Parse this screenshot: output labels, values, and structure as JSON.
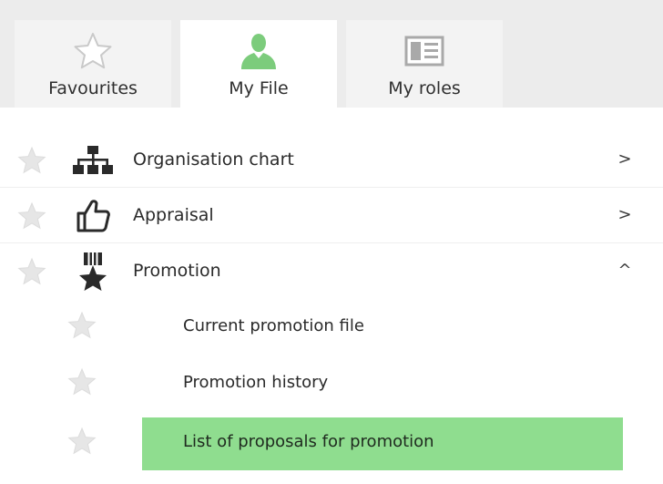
{
  "tabs": [
    {
      "label": "Favourites",
      "icon": "star-icon",
      "active": false
    },
    {
      "label": "My File",
      "icon": "person-icon",
      "active": true
    },
    {
      "label": "My roles",
      "icon": "id-card-icon",
      "active": false
    }
  ],
  "menu": {
    "items": [
      {
        "label": "Organisation chart",
        "icon": "org-chart-icon",
        "chevron": ">"
      },
      {
        "label": "Appraisal",
        "icon": "thumbs-up-icon",
        "chevron": ">"
      },
      {
        "label": "Promotion",
        "icon": "medal-icon",
        "chevron": "^"
      }
    ],
    "promotion_sub": [
      {
        "label": "Current promotion file"
      },
      {
        "label": "Promotion history"
      },
      {
        "label": "List of proposals for promotion",
        "selected": true
      }
    ]
  },
  "colors": {
    "accent_green": "#8fdd8f",
    "person_green": "#7ccc7c",
    "tab_bg": "#ececec"
  }
}
